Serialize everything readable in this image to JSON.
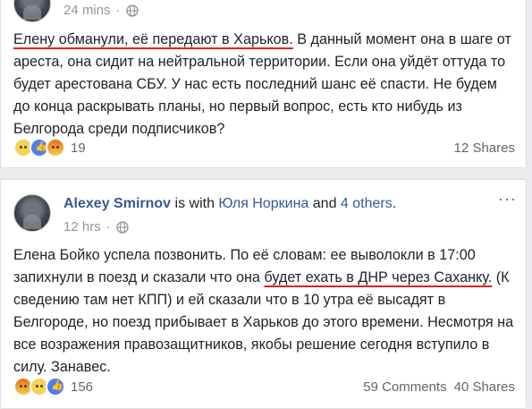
{
  "posts": [
    {
      "timestamp": "24 mins",
      "separator": "·",
      "text_underlined": "Елену обманули, её передают в Харьков.",
      "text_rest": " В данный момент она в шаге от ареста, она сидит на нейтральной территории. Если она уйдёт оттуда то будет арестована СБУ. У нас есть последний шанс её спасти. Не будем до конца раскрывать планы, но первый вопрос, есть кто нибудь из Белгорода среди подписчиков?",
      "reaction_count": "19",
      "shares": "12 Shares"
    },
    {
      "author": "Alexey Smirnov",
      "with_text": " is with ",
      "with_person": "Юля Норкина",
      "and_text": " and ",
      "others": "4 others",
      "period": ".",
      "timestamp": "12 hrs",
      "separator": "·",
      "text_before": "Елена Бойко успела позвонить. По её словам: ее выволокли в 17:00 запихнули в поезд и сказали что она ",
      "text_underlined": "будет ехать в ДНР через Саханку.",
      "text_after": " (К сведению там нет КПП) и ей сказали что в 10 утра её высадят в Белгороде, но поезд прибывает в Харьков до этого времени. Несмотря на все возражения правозащитников, якобы решение сегодня вступило в силу. Занавес.",
      "reaction_count": "156",
      "comments": "59 Comments",
      "shares": "40 Shares"
    }
  ],
  "icons": {
    "globe": "globe-icon",
    "more": "more-options-icon",
    "reactions": [
      "sad-reaction-icon",
      "like-reaction-icon",
      "angry-reaction-icon"
    ]
  },
  "colors": {
    "link": "#365899",
    "underline": "#e0211b",
    "meta": "#90949c",
    "like": "#4c7ef3"
  }
}
